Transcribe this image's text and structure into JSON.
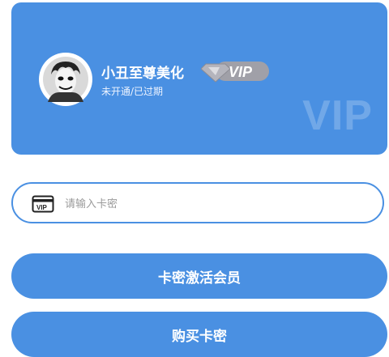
{
  "profile": {
    "username": "小丑至尊美化",
    "status": "未开通/已过期",
    "badge_text": "VIP",
    "watermark": "VIP",
    "avatar_icon": "joker-avatar-icon"
  },
  "redeem": {
    "placeholder": "请输入卡密",
    "value": "",
    "icon_label": "VIP",
    "icon": "vip-card-icon"
  },
  "actions": {
    "activate_label": "卡密激活会员",
    "buy_label": "购买卡密"
  },
  "colors": {
    "primary": "#4a90e2",
    "badge": "#a0a0a8"
  }
}
